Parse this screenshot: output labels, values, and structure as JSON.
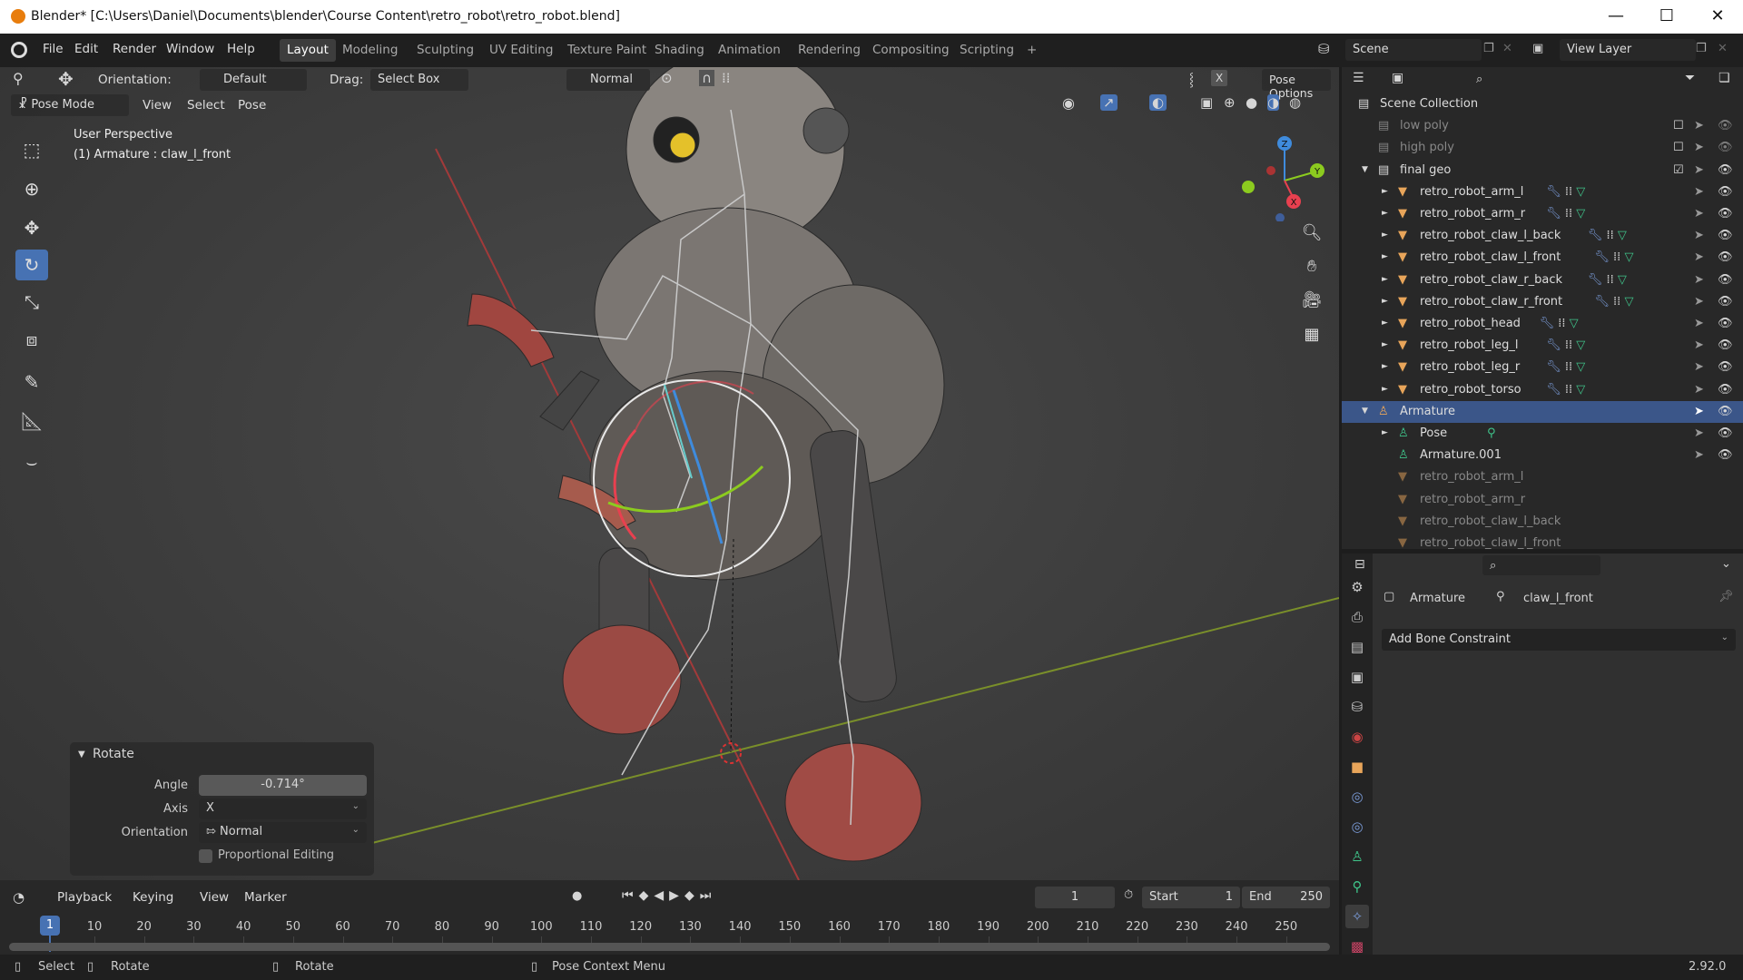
{
  "window": {
    "title": "Blender* [C:\\Users\\Daniel\\Documents\\blender\\Course Content\\retro_robot\\retro_robot.blend]",
    "minimize": "—",
    "maximize": "☐",
    "close": "✕"
  },
  "menu": {
    "items": [
      "File",
      "Edit",
      "Render",
      "Window",
      "Help"
    ],
    "workspaces": [
      "Layout",
      "Modeling",
      "Sculpting",
      "UV Editing",
      "Texture Paint",
      "Shading",
      "Animation",
      "Rendering",
      "Compositing",
      "Scripting"
    ],
    "active_workspace": "Layout",
    "add_workspace": "+",
    "scene": "Scene",
    "view_layer": "View Layer"
  },
  "tool_header": {
    "orientation_label": "Orientation:",
    "orientation_value": "Default",
    "drag_label": "Drag:",
    "drag_value": "Select Box",
    "pivot": "Normal",
    "pose_options": "Pose Options",
    "x_mirror": "X"
  },
  "viewport_header": {
    "mode": "Pose Mode",
    "view": "View",
    "select": "Select",
    "pose": "Pose"
  },
  "viewport": {
    "perspective": "User Perspective",
    "active": "(1) Armature : claw_l_front",
    "gizmo_axes": {
      "x": "X",
      "y": "Y",
      "z": "Z"
    },
    "colors": {
      "x": "#e8404f",
      "y": "#8ccb1f",
      "z": "#3f8bdc"
    }
  },
  "toolbar": [
    "select-box",
    "cursor",
    "move",
    "rotate",
    "scale",
    "transform",
    "annotate",
    "measure",
    "bone-roll"
  ],
  "active_tool": "rotate",
  "rotate_panel": {
    "title": "Rotate",
    "angle_label": "Angle",
    "angle": "-0.714°",
    "axis_label": "Axis",
    "axis": "X",
    "orientation_label": "Orientation",
    "orientation": "Normal",
    "proportional": "Proportional Editing",
    "proportional_checked": false
  },
  "outliner": {
    "rows": [
      {
        "label": "Scene Collection",
        "indent": 0,
        "type": "collection"
      },
      {
        "label": "low poly",
        "indent": 1,
        "type": "collection",
        "dim": true,
        "checked": false
      },
      {
        "label": "high poly",
        "indent": 1,
        "type": "collection",
        "dim": true,
        "checked": false
      },
      {
        "label": "final geo",
        "indent": 1,
        "type": "collection",
        "expanded": true,
        "checked": true
      },
      {
        "label": "retro_robot_arm_l",
        "indent": 2,
        "type": "mesh"
      },
      {
        "label": "retro_robot_arm_r",
        "indent": 2,
        "type": "mesh"
      },
      {
        "label": "retro_robot_claw_l_back",
        "indent": 2,
        "type": "mesh"
      },
      {
        "label": "retro_robot_claw_l_front",
        "indent": 2,
        "type": "mesh"
      },
      {
        "label": "retro_robot_claw_r_back",
        "indent": 2,
        "type": "mesh"
      },
      {
        "label": "retro_robot_claw_r_front",
        "indent": 2,
        "type": "mesh"
      },
      {
        "label": "retro_robot_head",
        "indent": 2,
        "type": "mesh"
      },
      {
        "label": "retro_robot_leg_l",
        "indent": 2,
        "type": "mesh"
      },
      {
        "label": "retro_robot_leg_r",
        "indent": 2,
        "type": "mesh"
      },
      {
        "label": "retro_robot_torso",
        "indent": 2,
        "type": "mesh"
      },
      {
        "label": "Armature",
        "indent": 1,
        "type": "armature",
        "selected": true,
        "expanded": true
      },
      {
        "label": "Pose",
        "indent": 2,
        "type": "pose"
      },
      {
        "label": "Armature.001",
        "indent": 2,
        "type": "armdata",
        "noarrow": true
      },
      {
        "label": "retro_robot_arm_l",
        "indent": 2,
        "type": "mesh",
        "dim": true,
        "noarrow": true
      },
      {
        "label": "retro_robot_arm_r",
        "indent": 2,
        "type": "mesh",
        "dim": true,
        "noarrow": true
      },
      {
        "label": "retro_robot_claw_l_back",
        "indent": 2,
        "type": "mesh",
        "dim": true,
        "noarrow": true
      },
      {
        "label": "retro_robot_claw_l_front",
        "indent": 2,
        "type": "mesh",
        "dim": true,
        "noarrow": true
      }
    ]
  },
  "properties": {
    "object": "Armature",
    "bone": "claw_l_front",
    "add_constraint": "Add Bone Constraint"
  },
  "timeline": {
    "playback": "Playback",
    "keying": "Keying",
    "view": "View",
    "marker": "Marker",
    "current_frame": "1",
    "start_label": "Start",
    "start": "1",
    "end_label": "End",
    "end": "250",
    "ticks": [
      "10",
      "20",
      "30",
      "40",
      "50",
      "60",
      "70",
      "80",
      "90",
      "100",
      "110",
      "120",
      "130",
      "140",
      "150",
      "160",
      "170",
      "180",
      "190",
      "200",
      "210",
      "220",
      "230",
      "240",
      "250"
    ]
  },
  "statusbar": {
    "select": "Select",
    "rotate1": "Rotate",
    "rotate2": "Rotate",
    "context": "Pose Context Menu",
    "version": "2.92.0"
  }
}
